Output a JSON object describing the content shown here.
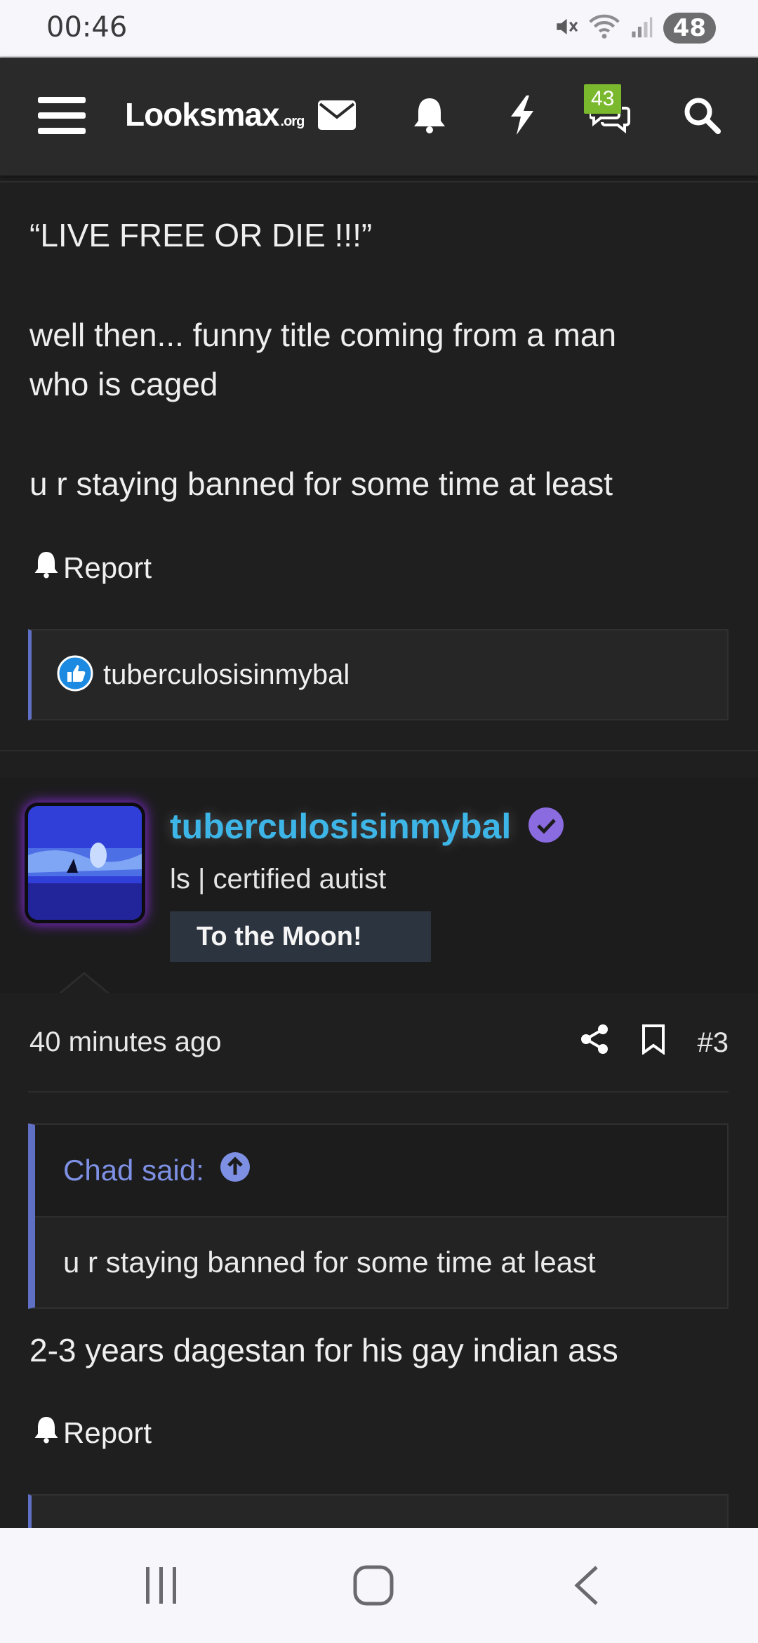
{
  "status_bar": {
    "time": "00:46",
    "battery": "48",
    "icons": [
      "mute-icon",
      "wifi-icon",
      "signal-icon"
    ]
  },
  "navbar": {
    "logo_main": "Looksmax",
    "logo_suffix": ".org",
    "unread_badge": "43",
    "icons": [
      "menu-icon",
      "mail-icon",
      "bell-icon",
      "lightning-icon",
      "chat-icon",
      "search-icon"
    ]
  },
  "post1": {
    "lines": [
      "“LIVE FREE OR DIE !!!”",
      "well then... funny title coming from a man",
      "who is caged",
      "u r staying banned for some time at least"
    ],
    "report_label": "Report",
    "reaction_user": "tuberculosisinmybal"
  },
  "post2": {
    "author": {
      "name": "tuberculosisinmybal",
      "title": "ls | certified autist",
      "banner": "To the Moon!"
    },
    "time": "40 minutes ago",
    "post_number": "#3",
    "quote": {
      "attribution": "Chad said:",
      "text": "u r staying banned for some time at least"
    },
    "body": "2-3 years dagestan for his gay indian ass",
    "report_label": "Report"
  },
  "colors": {
    "background": "#1f1f20",
    "navbar": "#2a2a2b",
    "accent": "#5e6fc4",
    "username": "#3db5e6",
    "badge": "#7ab92d",
    "verified": "#8a6be0"
  },
  "bottom_nav": {
    "icons": [
      "recents-icon",
      "home-icon",
      "back-icon"
    ]
  }
}
